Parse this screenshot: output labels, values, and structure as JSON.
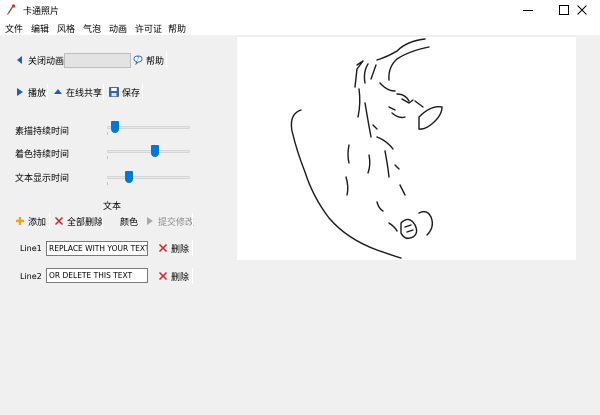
{
  "window": {
    "title": "卡通照片",
    "controls": [
      "minimize",
      "maximize",
      "close"
    ]
  },
  "menu": [
    "文件",
    "编辑",
    "风格",
    "气泡",
    "动画",
    "许可证",
    "帮助"
  ],
  "animation_bar": {
    "close_animation_label": "关闭动画",
    "help_label": "帮助",
    "field_value": ""
  },
  "action_bar": {
    "play_label": "播放",
    "share_label": "在线共享",
    "save_label": "保存"
  },
  "timing": {
    "sketch_duration_label": "素描持续时间",
    "sketch_duration_level": 0.05,
    "color_duration_label": "着色持续时间",
    "color_duration_level": 0.58,
    "text_duration_label": "文本显示时间",
    "text_duration_level": 0.24
  },
  "text_section": {
    "heading": "文本",
    "add_label": "添加",
    "delete_all_label": "全部删除",
    "color_label": "颜色",
    "commit_label": "提交修改",
    "lines": [
      {
        "label": "Line1",
        "value": "REPLACE WITH YOUR TEXT",
        "delete_label": "删除"
      },
      {
        "label": "Line2",
        "value": "OR DELETE THIS TEXT",
        "delete_label": "删除"
      }
    ]
  },
  "colors": {
    "accent": "#0078d7",
    "delete_red": "#d4202a",
    "add_orange": "#f0a020",
    "canvas_bg": "#ffffff",
    "window_bg": "#f0f0f0"
  }
}
